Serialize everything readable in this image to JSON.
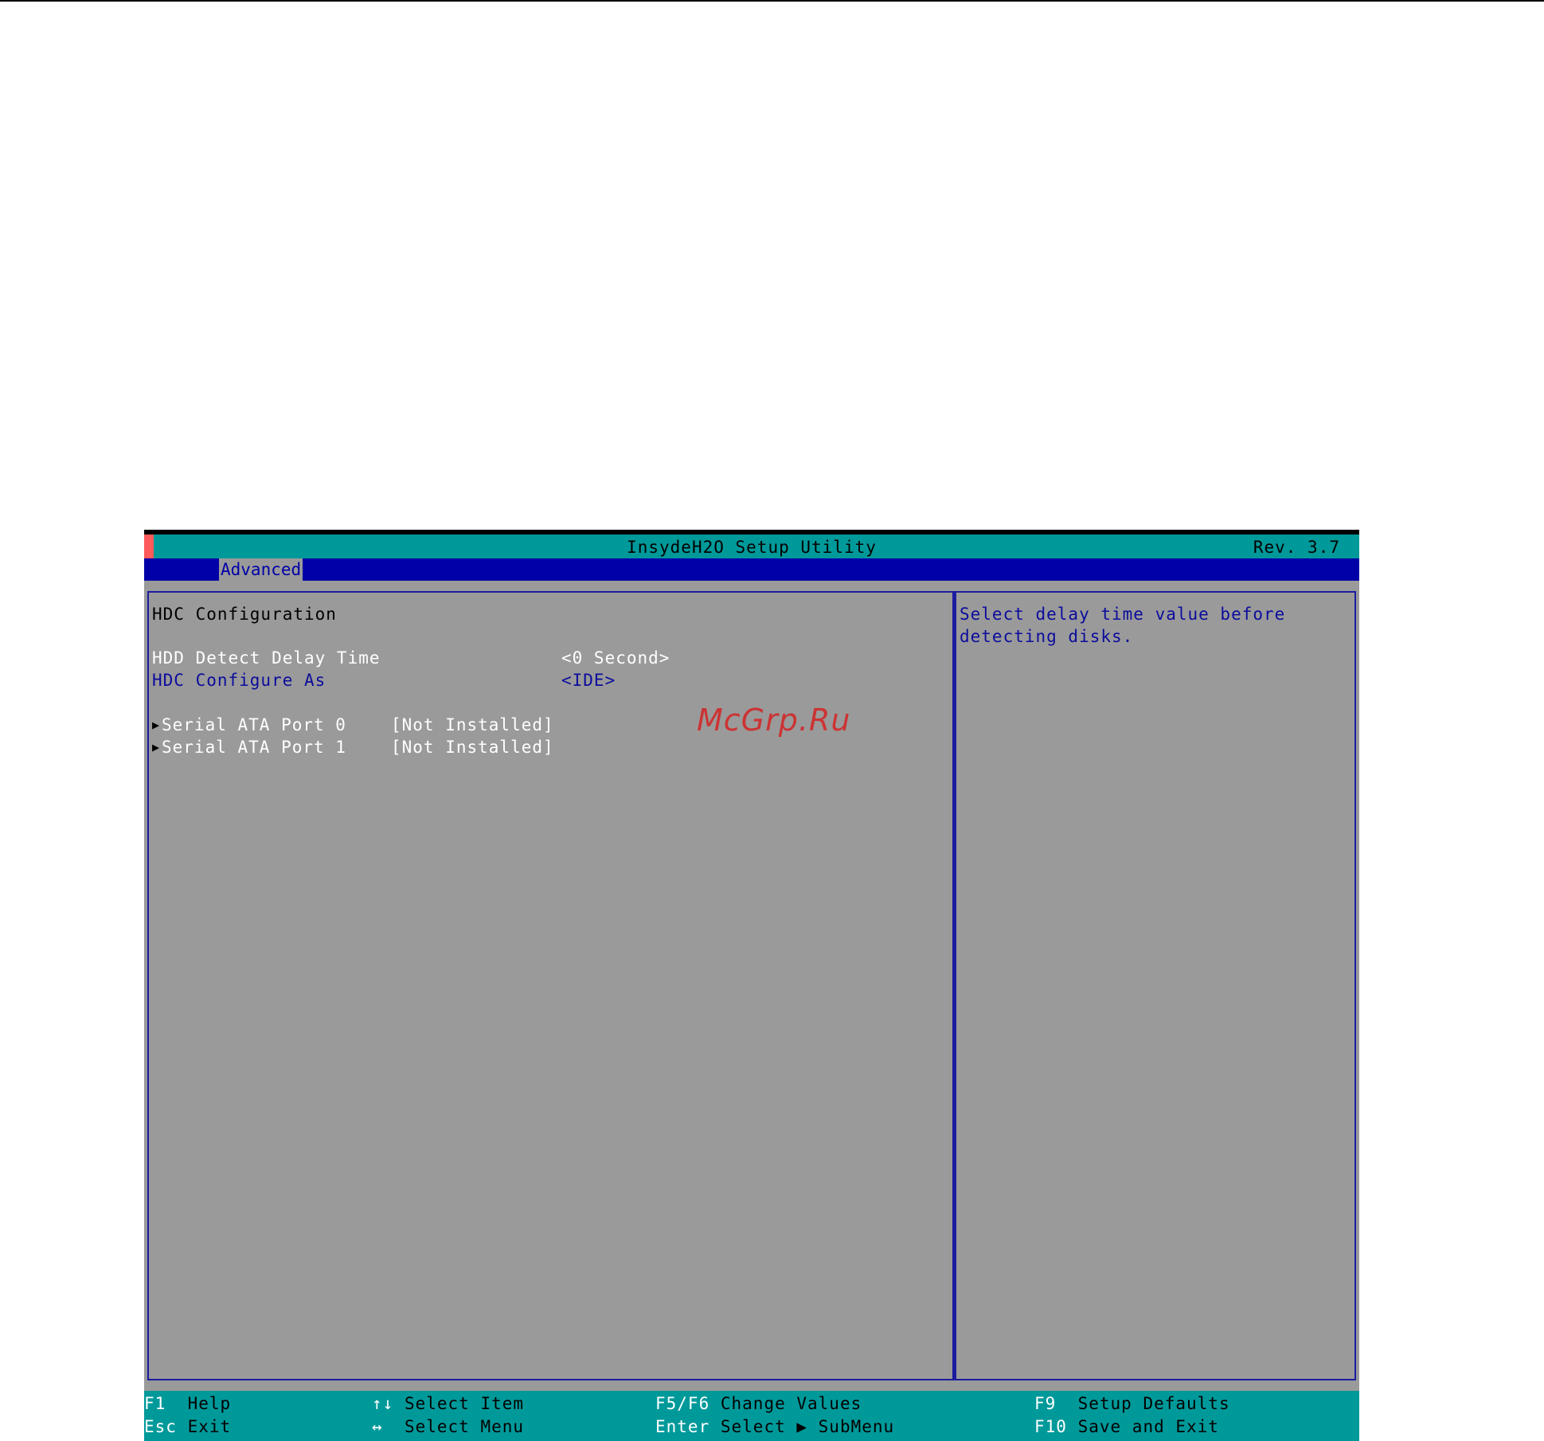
{
  "title_bar": {
    "title": "InsydeH2O Setup Utility",
    "revision": "Rev. 3.7"
  },
  "menu": {
    "tabs": [
      {
        "label": "Advanced",
        "active": true
      }
    ]
  },
  "main": {
    "heading": "HDC Configuration",
    "settings": [
      {
        "label": "HDD Detect Delay Time",
        "value": "<0 Second>"
      },
      {
        "label": "HDC Configure As",
        "value": "<IDE>"
      }
    ],
    "submenus": [
      {
        "label": "Serial ATA Port 0",
        "status": "[Not Installed]"
      },
      {
        "label": "Serial ATA Port 1",
        "status": "[Not Installed]"
      }
    ]
  },
  "help": {
    "text": "Select delay time value before detecting disks."
  },
  "watermark": "McGrp.Ru",
  "footer": {
    "keys": [
      {
        "key": "F1",
        "action": "Help"
      },
      {
        "key": "Esc",
        "action": "Exit"
      },
      {
        "key": "↑↓",
        "action": "Select Item"
      },
      {
        "key": "↔",
        "action": "Select Menu"
      },
      {
        "key": "F5/F6",
        "action": "Change Values"
      },
      {
        "key": "Enter",
        "action": "Select ▶ SubMenu"
      },
      {
        "key": "F9",
        "action": "Setup Defaults"
      },
      {
        "key": "F10",
        "action": "Save and Exit"
      }
    ]
  },
  "colors": {
    "title_bar": "#00999a",
    "menu_bar": "#0000a8",
    "panel_background": "#9a9a9a",
    "accent_red": "#ff5a5a"
  }
}
